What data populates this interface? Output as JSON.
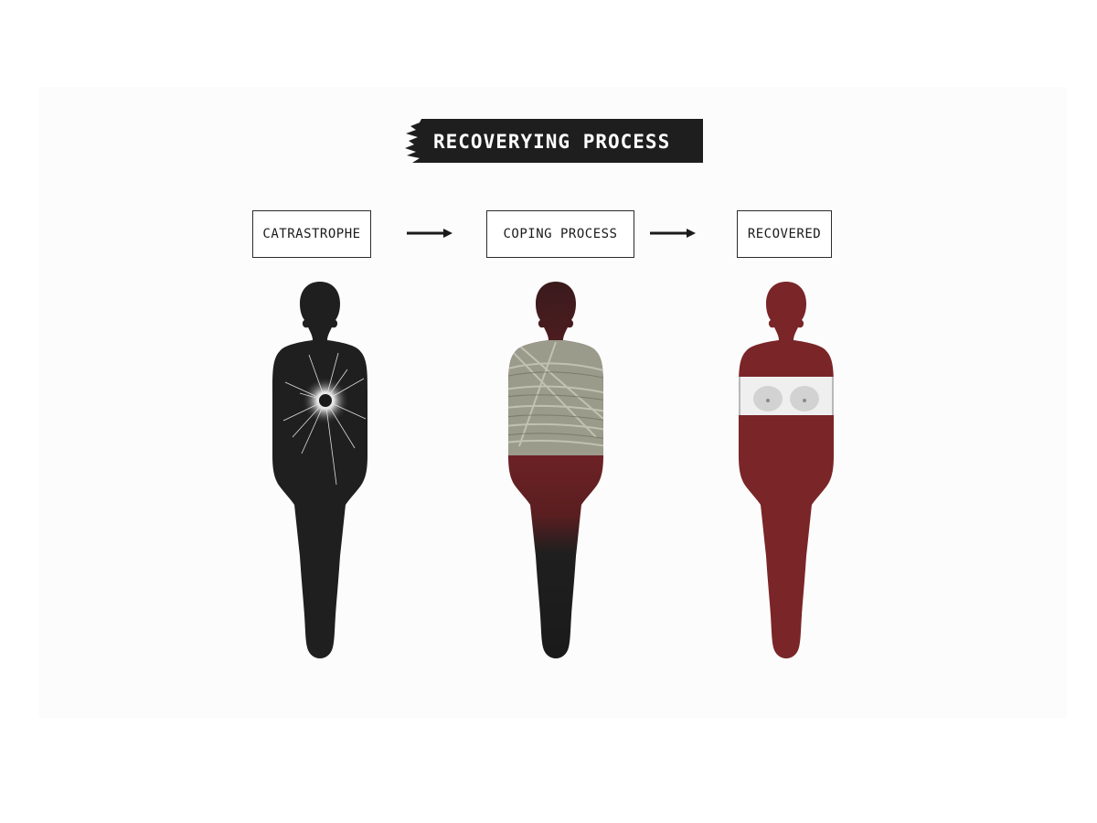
{
  "title": "RECOVERYING PROCESS",
  "stages": [
    {
      "label": "CATRASTROPHE"
    },
    {
      "label": "COPING PROCESS"
    },
    {
      "label": "RECOVERED"
    }
  ],
  "colors": {
    "background": "#ffffff",
    "banner": "#1e1e1e",
    "silhouette_dark": "#1f1f1f",
    "silhouette_red": "#7a2528",
    "bandage": "#9a9a8a",
    "box_border": "#2b2b2b"
  },
  "icons": [
    "arrow-right-icon",
    "arrow-right-icon",
    "shatter-crack-icon",
    "bandage-icon"
  ]
}
